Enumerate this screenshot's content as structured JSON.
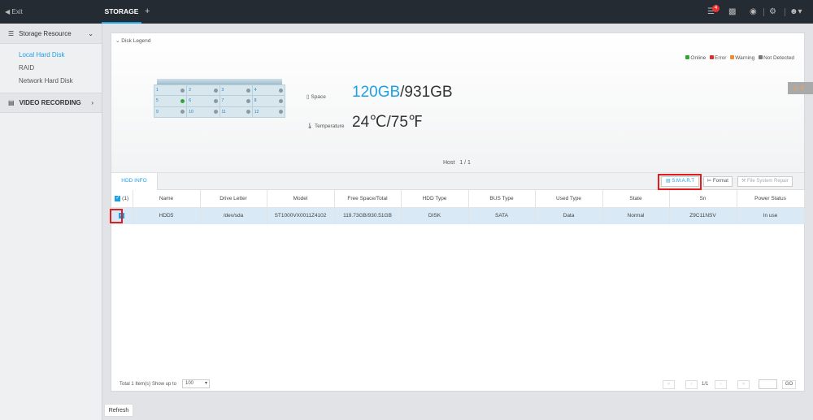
{
  "topbar": {
    "exit": "Exit",
    "tab": "STORAGE",
    "add": "+",
    "notification_count": "4"
  },
  "sidebar": {
    "storage_resource": "Storage Resource",
    "items": [
      "Local Hard Disk",
      "RAID",
      "Network Hard Disk"
    ],
    "video_recording": "VIDEO RECORDING"
  },
  "legend": {
    "title": "Disk Legend",
    "online": "Online",
    "error": "Error",
    "warning": "Warning",
    "not_detected": "Not Detected",
    "colors": {
      "online": "#2ea82e",
      "error": "#d93030",
      "warning": "#f08c2a",
      "not_detected": "#777777"
    }
  },
  "disk": {
    "slots": [
      "1",
      "2",
      "3",
      "4",
      "5",
      "6",
      "7",
      "8",
      "9",
      "10",
      "11",
      "12"
    ],
    "space_label": "Space",
    "space_used": "120GB",
    "space_total": "/931GB",
    "temp_label": "Temperature",
    "temperature": "24℃/75℉",
    "host_label": "Host",
    "host_page": "1 / 1"
  },
  "alert": {
    "count": "4"
  },
  "hdd": {
    "tab": "HDD INFO",
    "smart": "S.M.A.R.T",
    "format": "Format",
    "fs_repair": "File System Repair",
    "headers": [
      "(1)",
      "Name",
      "Drive Letter",
      "Model",
      "Free Space/Total",
      "HDD Type",
      "BUS Type",
      "Used Type",
      "State",
      "Sn",
      "Power Status"
    ],
    "rows": [
      [
        "HDD5",
        "/dev/sda",
        "ST1000VX0011Z4102",
        "119.73GB/930.51GB",
        "DISK",
        "SATA",
        "Data",
        "Normal",
        "Z9C11NSV",
        "In use"
      ]
    ]
  },
  "footer": {
    "total": "Total 1 Item(s)",
    "show_up_to": "Show up to",
    "page_size": "100",
    "page": "1/1",
    "go": "GO"
  },
  "refresh": "Refresh"
}
